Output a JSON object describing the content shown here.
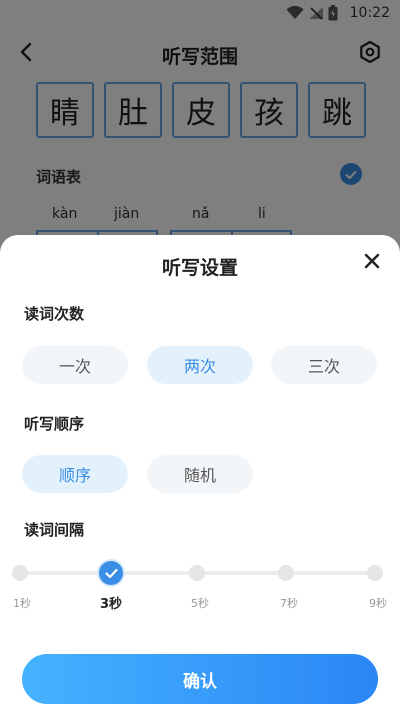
{
  "status_bar": {
    "time": "10:22"
  },
  "header": {
    "title": "听写范围"
  },
  "characters": [
    "睛",
    "肚",
    "皮",
    "孩",
    "跳"
  ],
  "word_list": {
    "label": "词语表",
    "pinyin": [
      "kàn",
      "jiàn",
      "nǎ",
      "li"
    ]
  },
  "sheet": {
    "title": "听写设置",
    "read_count": {
      "label": "读词次数",
      "options": [
        "一次",
        "两次",
        "三次"
      ],
      "selected": "两次"
    },
    "order": {
      "label": "听写顺序",
      "options": [
        "顺序",
        "随机"
      ],
      "selected": "顺序"
    },
    "interval": {
      "label": "读词间隔",
      "options": [
        "1秒",
        "3秒",
        "5秒",
        "7秒",
        "9秒"
      ],
      "selected": "3秒"
    },
    "confirm_label": "确认"
  },
  "colors": {
    "accent": "#3a8ee6",
    "selected_bg": "#e3f1fd",
    "button_gradient_start": "#45b3ff",
    "button_gradient_end": "#2a86f5"
  }
}
